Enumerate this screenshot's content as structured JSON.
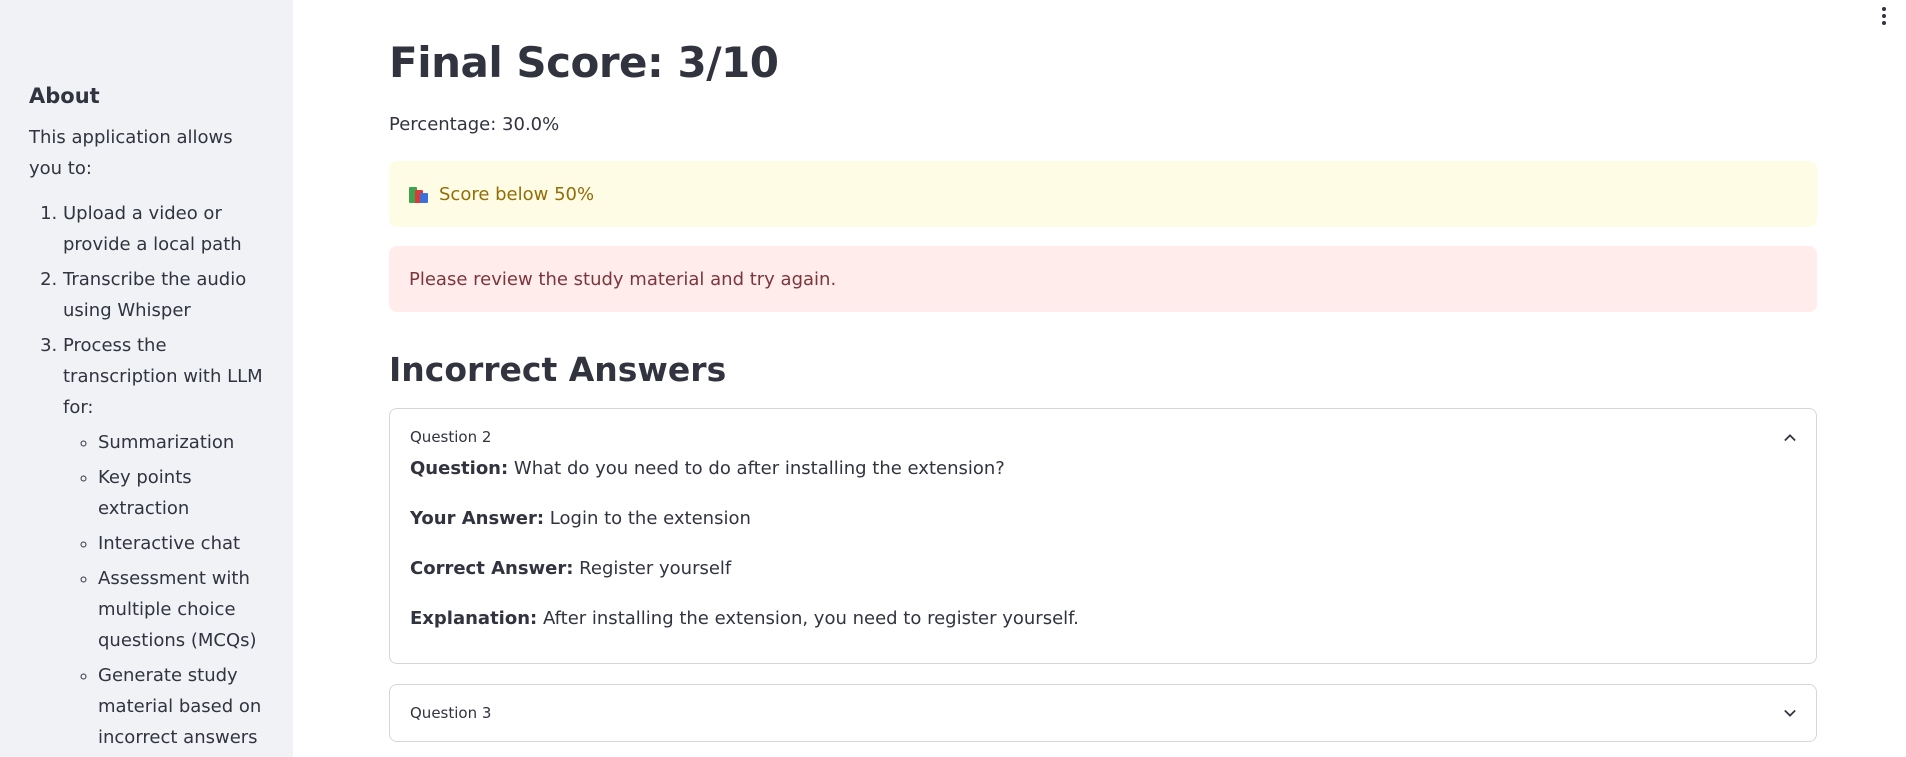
{
  "sidebar": {
    "heading": "About",
    "intro": "This application allows you to:",
    "steps": [
      "Upload a video or provide a local path",
      "Transcribe the audio using Whisper",
      "Process the transcription with LLM for:"
    ],
    "subitems": [
      "Summarization",
      "Key points extraction",
      "Interactive chat",
      "Assessment with multiple choice questions (MCQs)",
      "Generate study material based on incorrect answers"
    ]
  },
  "main": {
    "final_score": "Final Score: 3/10",
    "percentage": "Percentage: 30.0%",
    "warning_text": "Score below 50%",
    "error_text": "Please review the study material and try again.",
    "incorrect_heading": "Incorrect Answers",
    "expanders": [
      {
        "title": "Question 2",
        "expanded": true,
        "question_label": "Question:",
        "question": " What do you need to do after installing the extension?",
        "your_answer_label": "Your Answer:",
        "your_answer": " Login to the extension",
        "correct_answer_label": "Correct Answer:",
        "correct_answer": " Register yourself",
        "explanation_label": "Explanation:",
        "explanation": " After installing the extension, you need to register yourself."
      },
      {
        "title": "Question 3",
        "expanded": false
      }
    ]
  },
  "icons": {
    "warning": "books-icon",
    "menu": "vertical-ellipsis-icon",
    "collapse": "chevron-up-icon",
    "expand": "chevron-down-icon"
  },
  "colors": {
    "sidebar_bg": "#f0f2f6",
    "warning_bg": "#fffce6",
    "warning_text": "#926c05",
    "error_bg": "#ffeceb",
    "error_text": "#7d353b"
  }
}
